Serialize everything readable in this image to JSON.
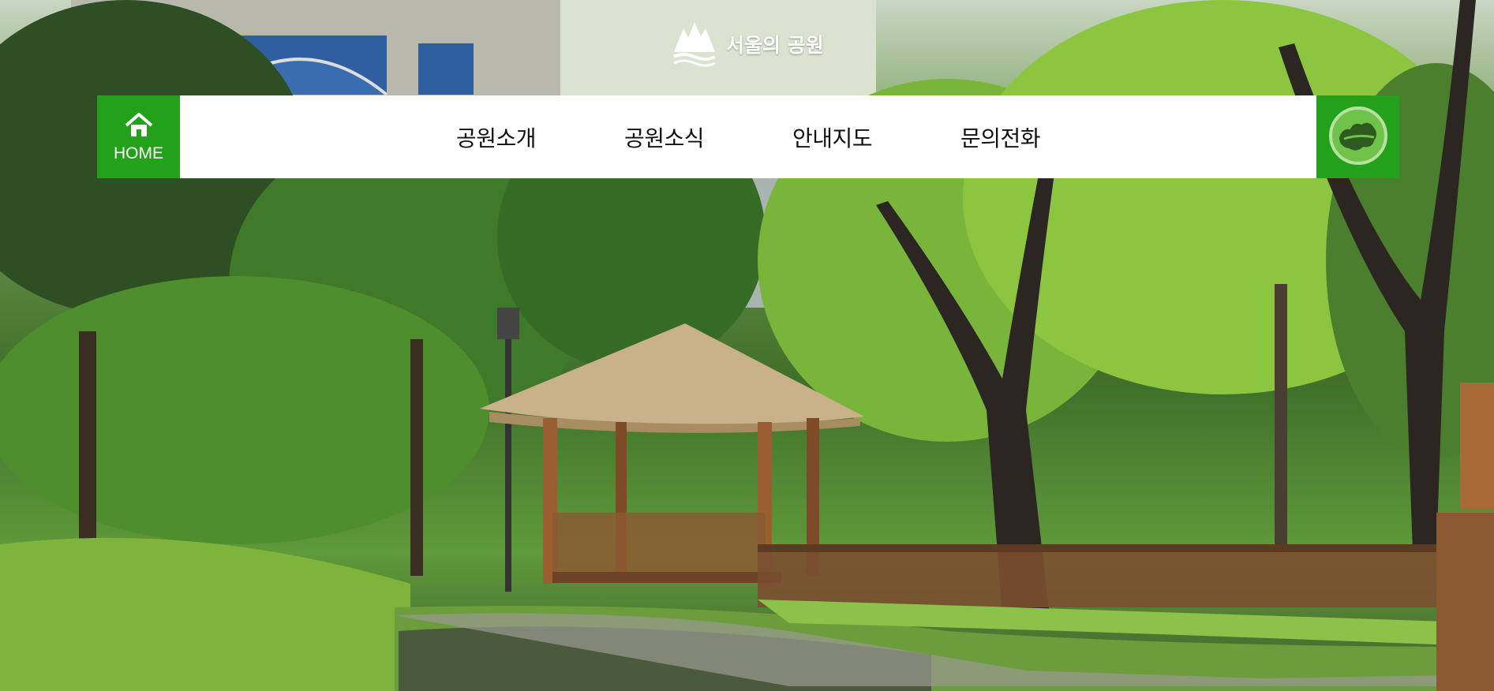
{
  "site": {
    "logo_text": "서울의 공원",
    "logo_icon": "seoul-park-logo-icon"
  },
  "nav": {
    "home_label": "HOME",
    "home_icon": "home-icon",
    "menu": [
      {
        "label": "공원소개"
      },
      {
        "label": "공원소식"
      },
      {
        "label": "안내지도"
      },
      {
        "label": "문의전화"
      }
    ],
    "map_icon": "seoul-map-icon"
  },
  "colors": {
    "accent": "#24a11b",
    "nav_bg": "#ffffff"
  }
}
